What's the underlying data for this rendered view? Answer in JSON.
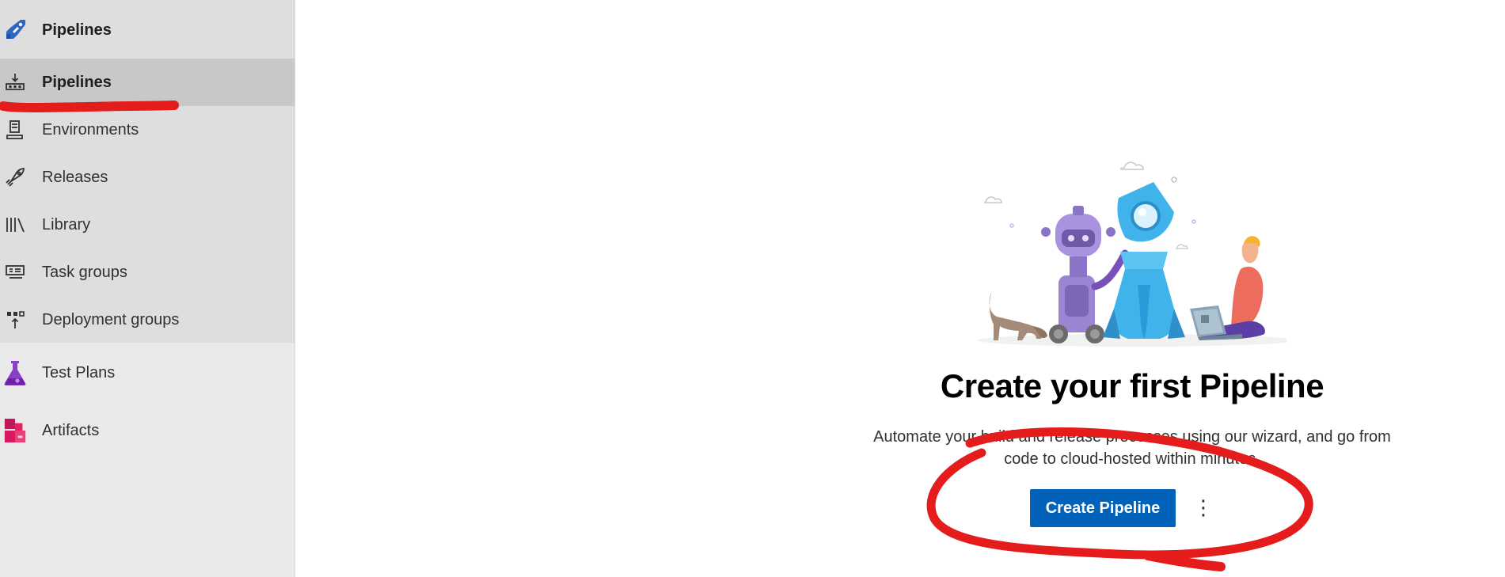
{
  "sidebar": {
    "header": {
      "label": "Pipelines",
      "icon": "azure-pipelines-icon"
    },
    "items": [
      {
        "label": "Pipelines",
        "icon": "pipelines-icon",
        "selected": true
      },
      {
        "label": "Environments",
        "icon": "environments-icon"
      },
      {
        "label": "Releases",
        "icon": "rocket-icon"
      },
      {
        "label": "Library",
        "icon": "library-icon"
      },
      {
        "label": "Task groups",
        "icon": "task-groups-icon"
      },
      {
        "label": "Deployment groups",
        "icon": "deployment-groups-icon"
      }
    ],
    "services": [
      {
        "label": "Test Plans",
        "icon": "test-plans-icon"
      },
      {
        "label": "Artifacts",
        "icon": "artifacts-icon"
      }
    ]
  },
  "main": {
    "title": "Create your first Pipeline",
    "description_line1": "Automate your build and release processes using our wizard, and go from",
    "description_line2": "code to cloud-hosted within minutes.",
    "primary_button": "Create Pipeline",
    "more_button": "⋮"
  },
  "colors": {
    "primary": "#0062b8",
    "sidebar_bg": "#eaeaea",
    "selected_bg": "#c8c8c8",
    "annotation": "#e51c1c"
  }
}
